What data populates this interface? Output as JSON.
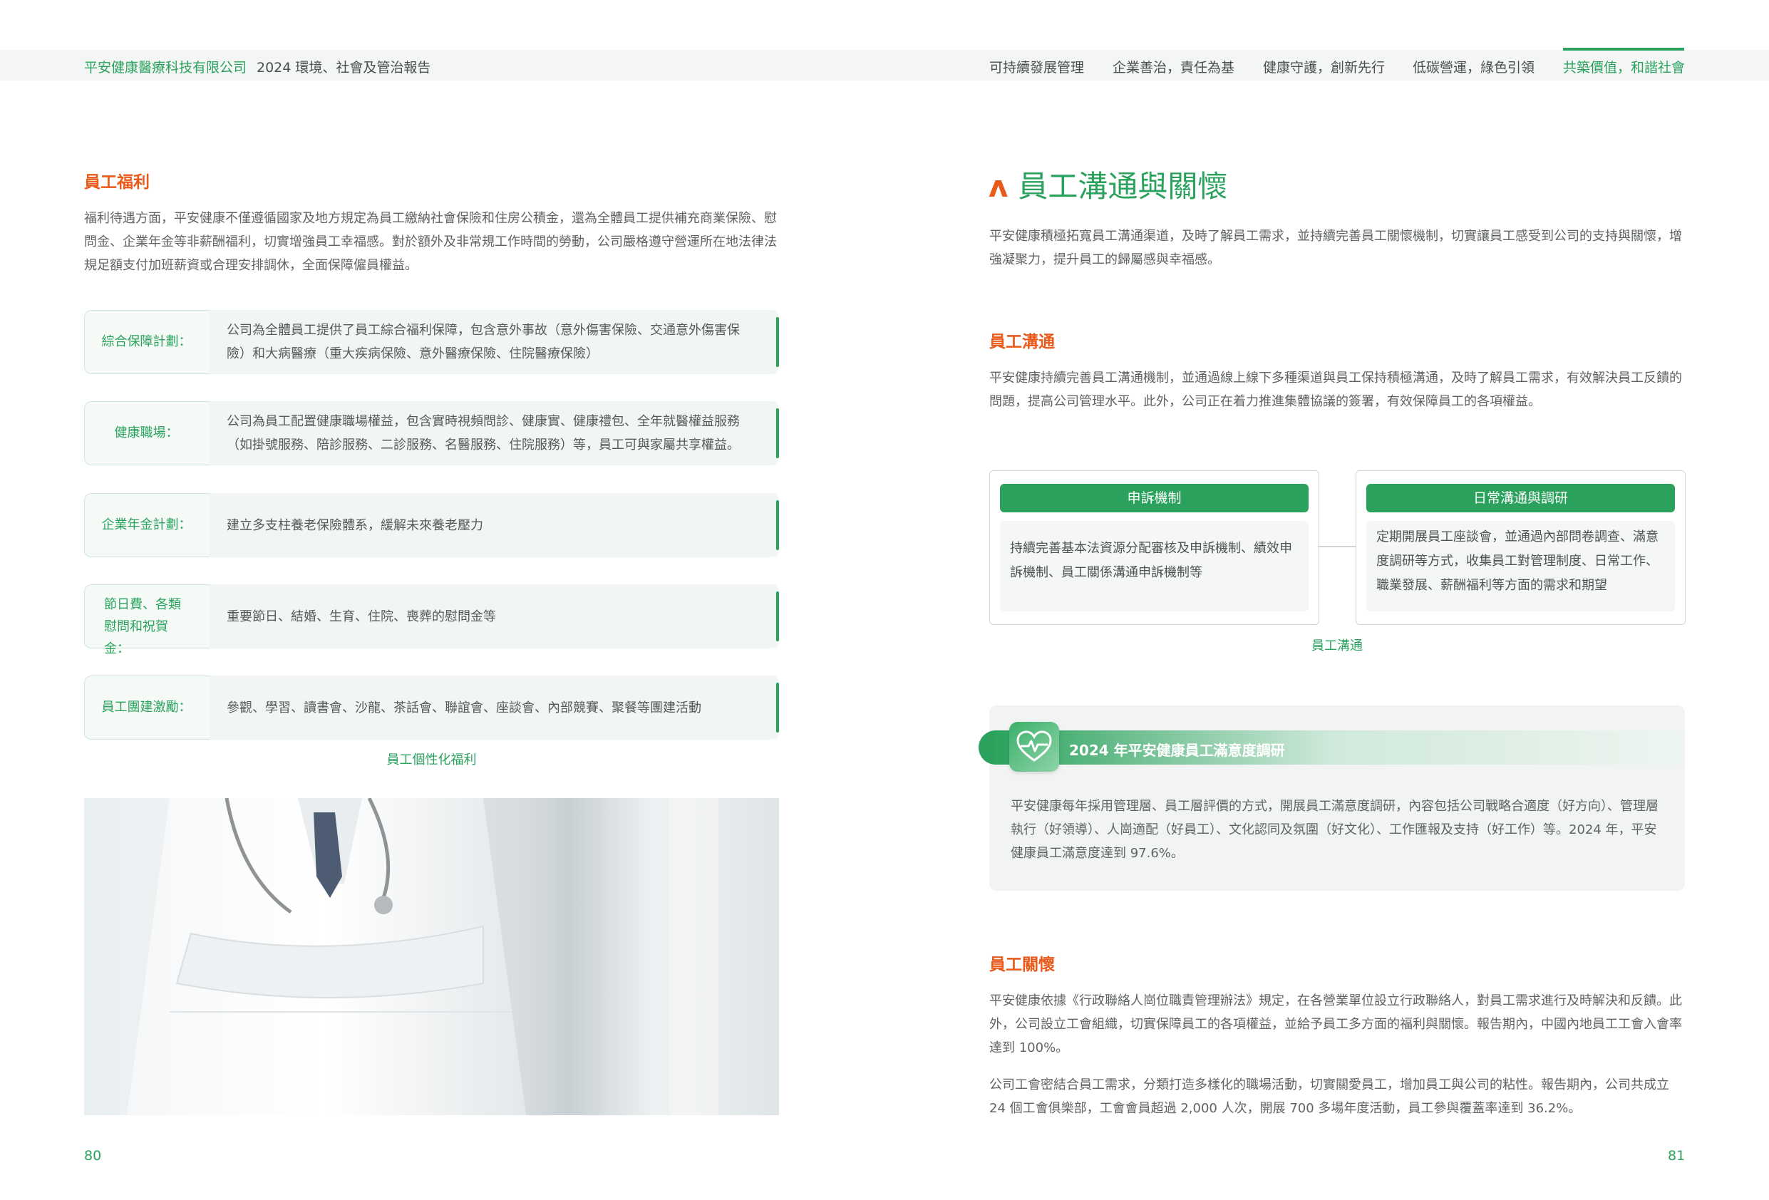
{
  "header": {
    "company": "平安健康醫療科技有限公司",
    "report": "2024 環境、社會及管治報告",
    "nav": [
      {
        "label": "可持續發展管理",
        "active": false
      },
      {
        "label": "企業善治，責任為基",
        "active": false
      },
      {
        "label": "健康守護，創新先行",
        "active": false
      },
      {
        "label": "低碳營運，綠色引領",
        "active": false
      },
      {
        "label": "共築價值，和諧社會",
        "active": true
      }
    ]
  },
  "left": {
    "heading": "員工福利",
    "intro": "福利待遇方面，平安健康不僅遵循國家及地方規定為員工繳納社會保險和住房公積金，還為全體員工提供補充商業保險、慰問金、企業年金等非薪酬福利，切實增強員工幸福感。對於額外及非常規工作時間的勞動，公司嚴格遵守營運所在地法律法規足額支付加班薪資或合理安排調休，全面保障僱員權益。",
    "benefits": [
      {
        "label": "綜合保障計劃：",
        "text": "公司為全體員工提供了員工綜合福利保障，包含意外事故（意外傷害保險、交通意外傷害保險）和大病醫療（重大疾病保險、意外醫療保險、住院醫療保險）"
      },
      {
        "label": "健康職場：",
        "text": "公司為員工配置健康職場權益，包含實時視頻問診、健康實、健康禮包、全年就醫權益服務（如掛號服務、陪診服務、二診服務、名醫服務、住院服務）等，員工可與家屬共享權益。"
      },
      {
        "label": "企業年金計劃：",
        "text": "建立多支柱養老保險體系，緩解未來養老壓力"
      },
      {
        "label": "節日費、各類慰問和祝賀金：",
        "text": "重要節日、結婚、生育、住院、喪葬的慰問金等"
      },
      {
        "label": "員工團建激勵：",
        "text": "參觀、學習、讀書會、沙龍、茶話會、聯誼會、座談會、內部競賽、聚餐等團建活動"
      }
    ],
    "caption": "員工個性化福利",
    "page_number": "80"
  },
  "right": {
    "title": "員工溝通與關懷",
    "intro": "平安健康積極拓寬員工溝通渠道，及時了解員工需求，並持續完善員工關懷機制，切實讓員工感受到公司的支持與關懷，增強凝聚力，提升員工的歸屬感與幸福感。",
    "comm_heading": "員工溝通",
    "comm_text": "平安健康持續完善員工溝通機制，並通過線上線下多種渠道與員工保持積極溝通，及時了解員工需求，有效解決員工反饋的問題，提高公司管理水平。此外，公司正在着力推進集體協議的簽署，有效保障員工的各項權益。",
    "cards": [
      {
        "title": "申訴機制",
        "text": "持續完善基本法資源分配審核及申訴機制、績效申訴機制、員工關係溝通申訴機制等"
      },
      {
        "title": "日常溝通與調研",
        "text": "定期開展員工座談會，並通過內部問卷調查、滿意度調研等方式，收集員工對管理制度、日常工作、職業發展、薪酬福利等方面的需求和期望"
      }
    ],
    "cards_caption": "員工溝通",
    "survey_title": "2024 年平安健康員工滿意度調研",
    "survey_text": "平安健康每年採用管理層、員工層評價的方式，開展員工滿意度調研，內容包括公司戰略合適度（好方向）、管理層執行（好領導）、人崗適配（好員工）、文化認同及氛圍（好文化）、工作匯報及支持（好工作）等。2024 年，平安健康員工滿意度達到 97.6%。",
    "care_heading": "員工關懷",
    "care_text_1": "平安健康依據《行政聯絡人崗位職責管理辦法》規定，在各營業單位設立行政聯絡人，對員工需求進行及時解決和反饋。此外，公司設立工會組織，切實保障員工的各項權益，並給予員工多方面的福利與關懷。報告期內，中國內地員工工會入會率達到 100%。",
    "care_text_2": "公司工會密結合員工需求，分類打造多樣化的職場活動，切實關愛員工，增加員工與公司的粘性。報告期內，公司共成立 24 個工會俱樂部，工會會員超過 2,000 人次，開展 700 多場年度活動，員工參與覆蓋率達到 36.2%。",
    "page_number": "81"
  },
  "colors": {
    "brand_green": "#2aa25d",
    "accent_orange": "#ea5a1b"
  },
  "icons": {
    "survey": "heart-pulse-icon"
  }
}
